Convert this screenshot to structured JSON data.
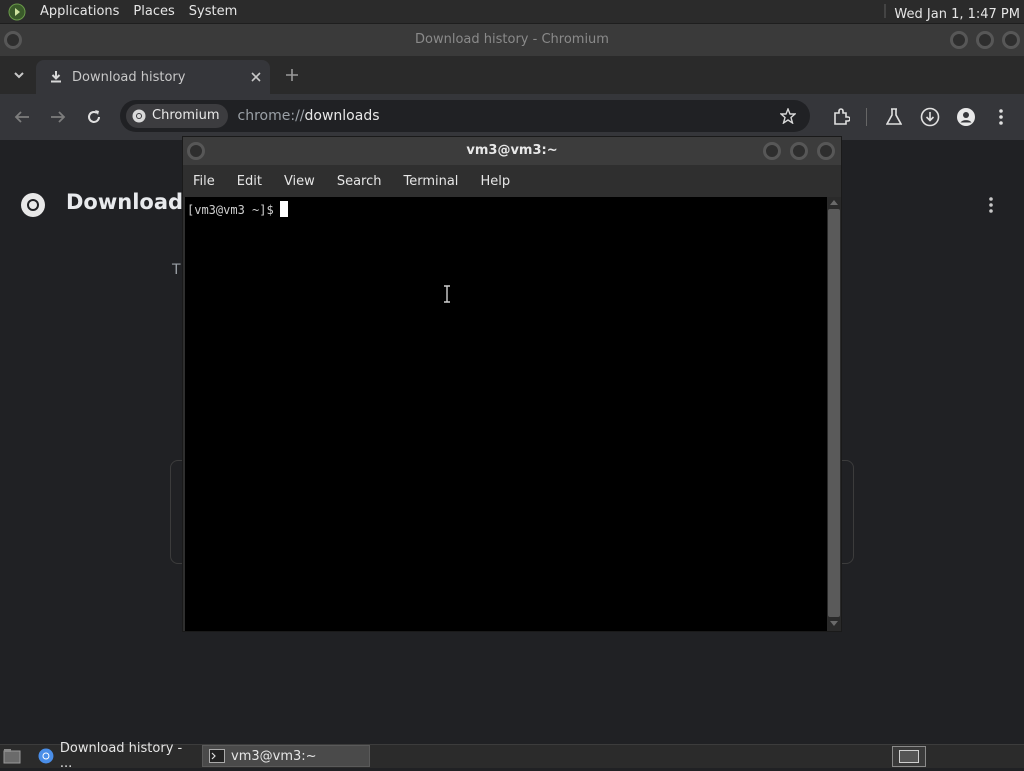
{
  "panel": {
    "applications": "Applications",
    "places": "Places",
    "system": "System",
    "clock": "Wed Jan  1,  1:47 PM"
  },
  "chromium": {
    "window_title": "Download history - Chromium",
    "tab_title": "Download history",
    "site_chip": "Chromium",
    "url_prefix": "chrome://",
    "url_host": "downloads",
    "page_heading": "Download h",
    "partial_text": "T"
  },
  "terminal": {
    "title": "vm3@vm3:~",
    "menu": [
      "File",
      "Edit",
      "View",
      "Search",
      "Terminal",
      "Help"
    ],
    "prompt": "[vm3@vm3 ~]$"
  },
  "taskbar": {
    "items": [
      "Download history - ...",
      "vm3@vm3:~"
    ]
  },
  "colors": {
    "chrome_bg": "#202124",
    "terminal_bg": "#000000",
    "panel_bg": "#2b2b2b"
  }
}
